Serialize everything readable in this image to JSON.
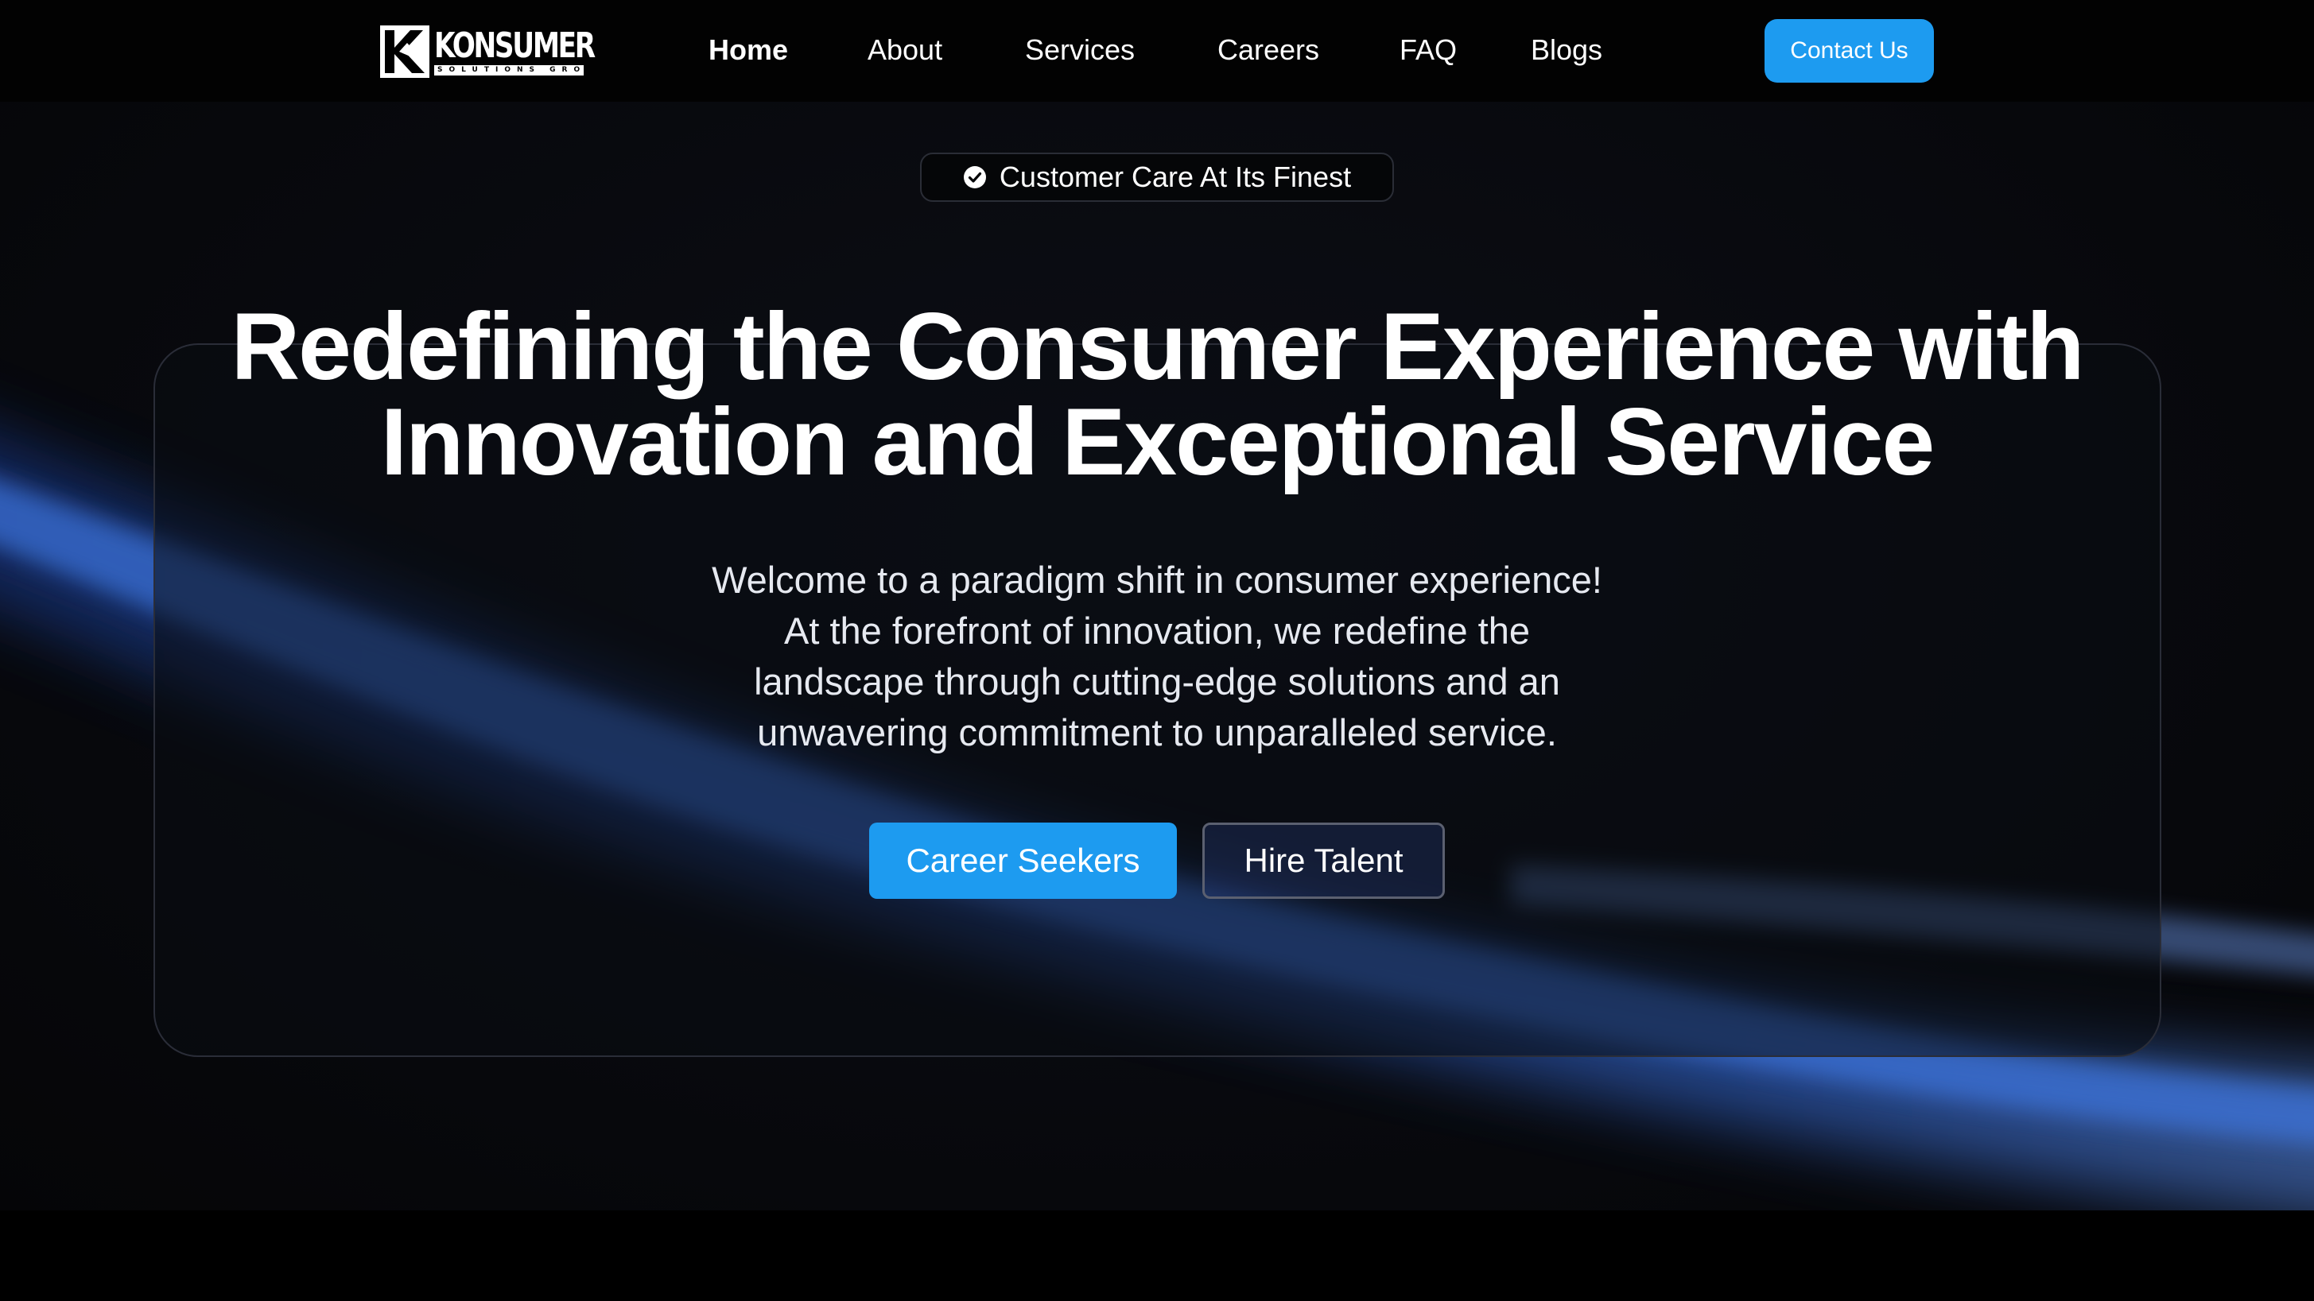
{
  "brand": {
    "name": "KONSUMER",
    "tagline": "SOLUTIONS GROUP",
    "logo_icon": "konsumer-k-logo-icon"
  },
  "nav": {
    "items": [
      {
        "label": "Home",
        "active": true
      },
      {
        "label": "About",
        "active": false
      },
      {
        "label": "Services",
        "active": false
      },
      {
        "label": "Careers",
        "active": false
      },
      {
        "label": "FAQ",
        "active": false
      },
      {
        "label": "Blogs",
        "active": false
      }
    ],
    "contact_label": "Contact Us"
  },
  "hero": {
    "badge_icon": "check-circle-icon",
    "badge_text": "Customer Care At Its Finest",
    "headline_lines": [
      "Redefining the Consumer Experience with",
      "Innovation and Exceptional Service"
    ],
    "intro_lines": [
      "Welcome to a paradigm shift in consumer experience!",
      "At the forefront of innovation, we redefine the",
      "landscape through cutting-edge solutions and an",
      "unwavering commitment to unparalleled service."
    ],
    "primary_cta": "Career Seekers",
    "secondary_cta": "Hire Talent"
  },
  "colors": {
    "accent": "#1d9bf0",
    "background": "#07080c",
    "beam": "#3a6ee0"
  }
}
